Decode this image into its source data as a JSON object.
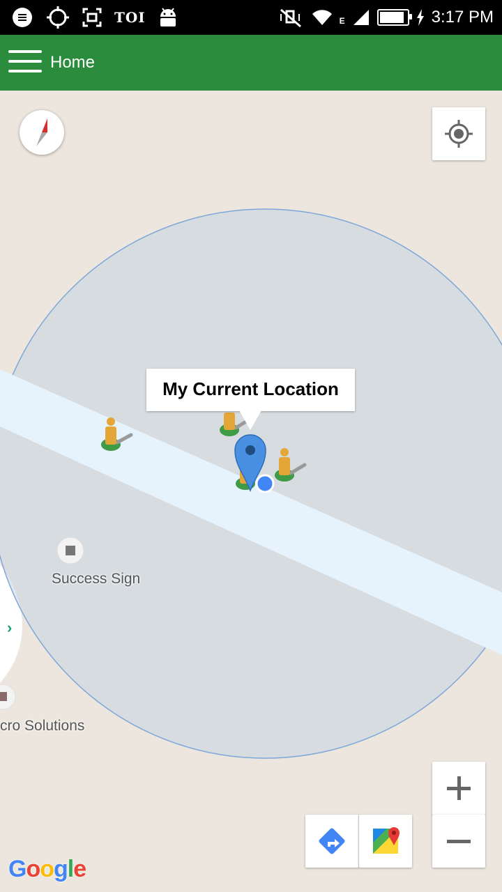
{
  "status_bar": {
    "carrier_label": "TOI",
    "network_label": "E",
    "time": "3:17 PM",
    "icons": [
      "chat-bubble-icon",
      "crosshair-icon",
      "screenshot-icon",
      "android-icon",
      "mute-vibrate-icon",
      "wifi-icon",
      "signal-icon",
      "battery-icon",
      "charging-icon"
    ]
  },
  "app_bar": {
    "title": "Home",
    "menu_icon": "hamburger-menu-icon"
  },
  "map": {
    "info_window_title": "My Current Location",
    "poi_labels": [
      "Success Sign",
      "cro Solutions"
    ],
    "logo_text": "Google",
    "controls": {
      "compass": "compass-icon",
      "my_location": "my-location-icon",
      "zoom_in": "+",
      "zoom_out": "−",
      "directions": "directions-icon",
      "open_in_maps": "google-maps-icon"
    },
    "colors": {
      "app_bar": "#2a8c3c",
      "map_bg": "#ece6de",
      "accuracy_circle": "#7da7d9",
      "marker": "#4a90e2"
    }
  }
}
